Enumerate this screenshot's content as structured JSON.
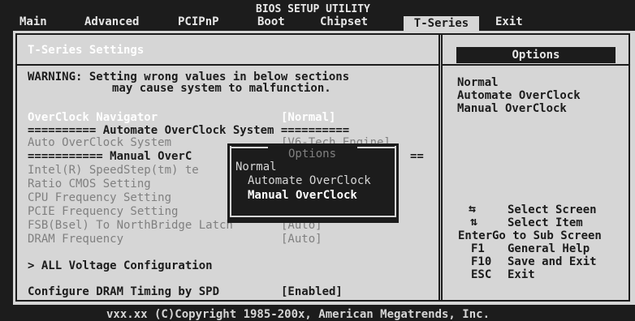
{
  "header": {
    "title": "BIOS SETUP UTILITY",
    "tabs": [
      "Main",
      "Advanced",
      "PCIPnP",
      "Boot",
      "Chipset",
      "T-Series",
      "Exit"
    ],
    "active_tab": "T-Series"
  },
  "main": {
    "section_title": "T-Series Settings",
    "warning_line1": "WARNING: Setting wrong values in below sections",
    "warning_line2": "may cause system to malfunction.",
    "overclock_nav_label": "OverClock Navigator",
    "overclock_nav_value": "[Normal]",
    "auto_sep": "========== Automate OverClock System ==========",
    "auto_system_label": "Auto OverClock System",
    "auto_system_value": "[V6-Tech Engine]",
    "manual_sep_left": "=========== Manual OverC",
    "manual_sep_right": "==",
    "items": [
      {
        "label": "Intel(R) SpeedStep(tm) te"
      },
      {
        "label": "Ratio CMOS Setting"
      },
      {
        "label": "CPU Frequency Setting"
      },
      {
        "label": "PCIE Frequency Setting"
      },
      {
        "label": "FSB(Bsel) To NorthBridge Latch",
        "value": "[Auto]"
      },
      {
        "label": "DRAM Frequency",
        "value": "[Auto]"
      }
    ],
    "voltage_label": "> ALL Voltage Configuration",
    "dram_timing_label": "Configure DRAM Timing by SPD",
    "dram_timing_value": "[Enabled]"
  },
  "popup": {
    "title": "Options",
    "options": [
      "Normal",
      "Automate OverClock",
      "Manual OverClock"
    ],
    "selected_index": 2
  },
  "help_panel": {
    "header": "Options",
    "options": [
      "Normal",
      "Automate OverClock",
      "Manual OverClock"
    ],
    "keys": [
      {
        "icon": "left-right-arrows-icon",
        "key": "",
        "desc": "Select Screen"
      },
      {
        "icon": "up-down-arrows-icon",
        "key": "",
        "desc": "Select Item"
      },
      {
        "key": "Enter",
        "desc": "Go to Sub Screen"
      },
      {
        "key": "F1",
        "desc": "General Help"
      },
      {
        "key": "F10",
        "desc": "Save and Exit"
      },
      {
        "key": "ESC",
        "desc": "Exit"
      }
    ]
  },
  "footer": {
    "copyright": "vxx.xx (C)Copyright 1985-200x, American Megatrends, Inc."
  },
  "colors": {
    "background": "#1c1c1c",
    "panel": "#d6d6d6",
    "highlight_text": "#ffffff",
    "dim_text": "#808080"
  }
}
